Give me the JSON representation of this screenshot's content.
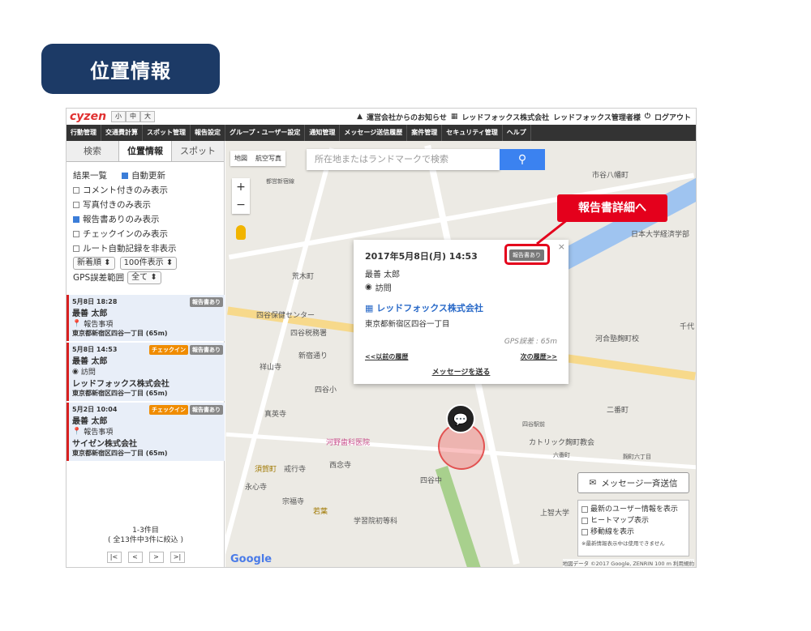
{
  "banner": {
    "title": "位置情報"
  },
  "topbar": {
    "logo": "cyzen",
    "sizes": [
      "小",
      "中",
      "大"
    ],
    "notice": "運営会社からのお知らせ",
    "company": "レッドフォックス株式会社",
    "user": "レッドフォックス管理者様",
    "logout": "ログアウト"
  },
  "menu": [
    "行動管理",
    "交通費計算",
    "スポット管理",
    "報告設定",
    "グループ・ユーザー設定",
    "通知管理",
    "メッセージ送信履歴",
    "案件管理",
    "セキュリティ管理",
    "ヘルプ"
  ],
  "sidebar": {
    "tabs": [
      "検索",
      "位置情報",
      "スポット"
    ],
    "results_label": "結果一覧",
    "auto_update": "自動更新",
    "filters": [
      {
        "label": "コメント付きのみ表示",
        "checked": false
      },
      {
        "label": "写真付きのみ表示",
        "checked": false
      },
      {
        "label": "報告書ありのみ表示",
        "checked": true
      },
      {
        "label": "チェックインのみ表示",
        "checked": false
      },
      {
        "label": "ルート自動記録を非表示",
        "checked": false
      }
    ],
    "sort": "新着順",
    "per_page": "100件表示",
    "gps_label": "GPS誤差範囲",
    "gps_value": "全て",
    "items": [
      {
        "date": "5月8日 18:28",
        "name": "最善 太郎",
        "kind": "報告事項",
        "company": "",
        "addr": "東京都新宿区四谷一丁目 (65m)",
        "badges": [
          "報告書あり"
        ]
      },
      {
        "date": "5月8日 14:53",
        "name": "最善 太郎",
        "kind": "訪問",
        "company": "レッドフォックス株式会社",
        "addr": "東京都新宿区四谷一丁目 (65m)",
        "badges": [
          "チェックイン",
          "報告書あり"
        ]
      },
      {
        "date": "5月2日 10:04",
        "name": "最善 太郎",
        "kind": "報告事項",
        "company": "サイゼン株式会社",
        "addr": "東京都新宿区四谷一丁目 (65m)",
        "badges": [
          "チェックイン",
          "報告書あり"
        ]
      }
    ],
    "pager_range": "1-3件目",
    "pager_total": "( 全13件中3件に絞込 )",
    "pager_btns": [
      "|<",
      "<",
      ">",
      ">|"
    ]
  },
  "map": {
    "type_tabs": [
      "地図",
      "航空写真"
    ],
    "search_placeholder": "所在地またはランドマークで検索",
    "labels": [
      "市谷八幡町",
      "日本大学経済学部",
      "荒木町",
      "四谷保健センター",
      "四谷税務署",
      "祥山寺",
      "四谷小",
      "真英寺",
      "河野歯科医院",
      "須賀町",
      "戒行寺",
      "西念寺",
      "永心寺",
      "宗福寺",
      "若葉",
      "学習院初等科",
      "四谷中",
      "上智大学",
      "カトリック麹町教会",
      "二番町",
      "六番町",
      "河合塾麹町校",
      "四谷駅前",
      "都営新宿線",
      "新宿通り",
      "麹町六丁目",
      "千代"
    ],
    "google": "Google",
    "copyright": "地図データ ©2017 Google, ZENRIN   100 m   利用規約"
  },
  "popup": {
    "date": "2017年5月8日(月) 14:53",
    "name": "最善 太郎",
    "kind": "訪問",
    "company": "レッドフォックス株式会社",
    "addr": "東京都新宿区四谷一丁目",
    "gps": "GPS誤差 : 65m",
    "prev": "<<以前の履歴",
    "next": "次の履歴>>",
    "send": "メッセージを送る",
    "badge": "報告書あり"
  },
  "callout": "報告書詳細へ",
  "message_button": "メッセージ一斉送信",
  "layers": {
    "items": [
      "最新のユーザー情報を表示",
      "ヒートマップ表示",
      "移動線を表示"
    ],
    "note": "※最新情報表示中は使用できません"
  }
}
